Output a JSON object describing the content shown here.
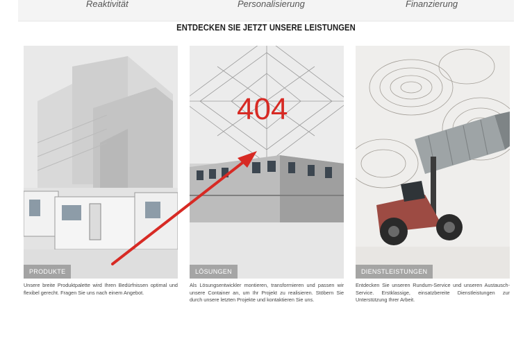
{
  "nav": {
    "items": [
      "Reaktivität",
      "Personalisierung",
      "Finanzierung"
    ]
  },
  "heading": "ENTDECKEN SIE JETZT UNSERE LEISTUNGEN",
  "cards": [
    {
      "label": "PRODUKTE",
      "text": "Unsere breite Produktpalette wird Ihren Bedürfnissen optimal und flexibel gerecht. Fragen Sie uns nach einem Angebot."
    },
    {
      "label": "LÖSUNGEN",
      "text": "Als Lösungsentwickler montieren, transformieren und passen wir unsere Container an, um Ihr Projekt zu realisieren. Stöbern Sie durch unsere letzten Projekte und kontaktieren Sie uns."
    },
    {
      "label": "DIENSTLEISTUNGEN",
      "text": "Entdecken Sie unseren Rundum-Service und unseren Austausch-Service. Erstklassige, einsatzbereite Dienstleistungen zur Unterstützung Ihrer Arbeit."
    }
  ],
  "annotation": {
    "error_text": "404",
    "color": "#d72a24"
  }
}
